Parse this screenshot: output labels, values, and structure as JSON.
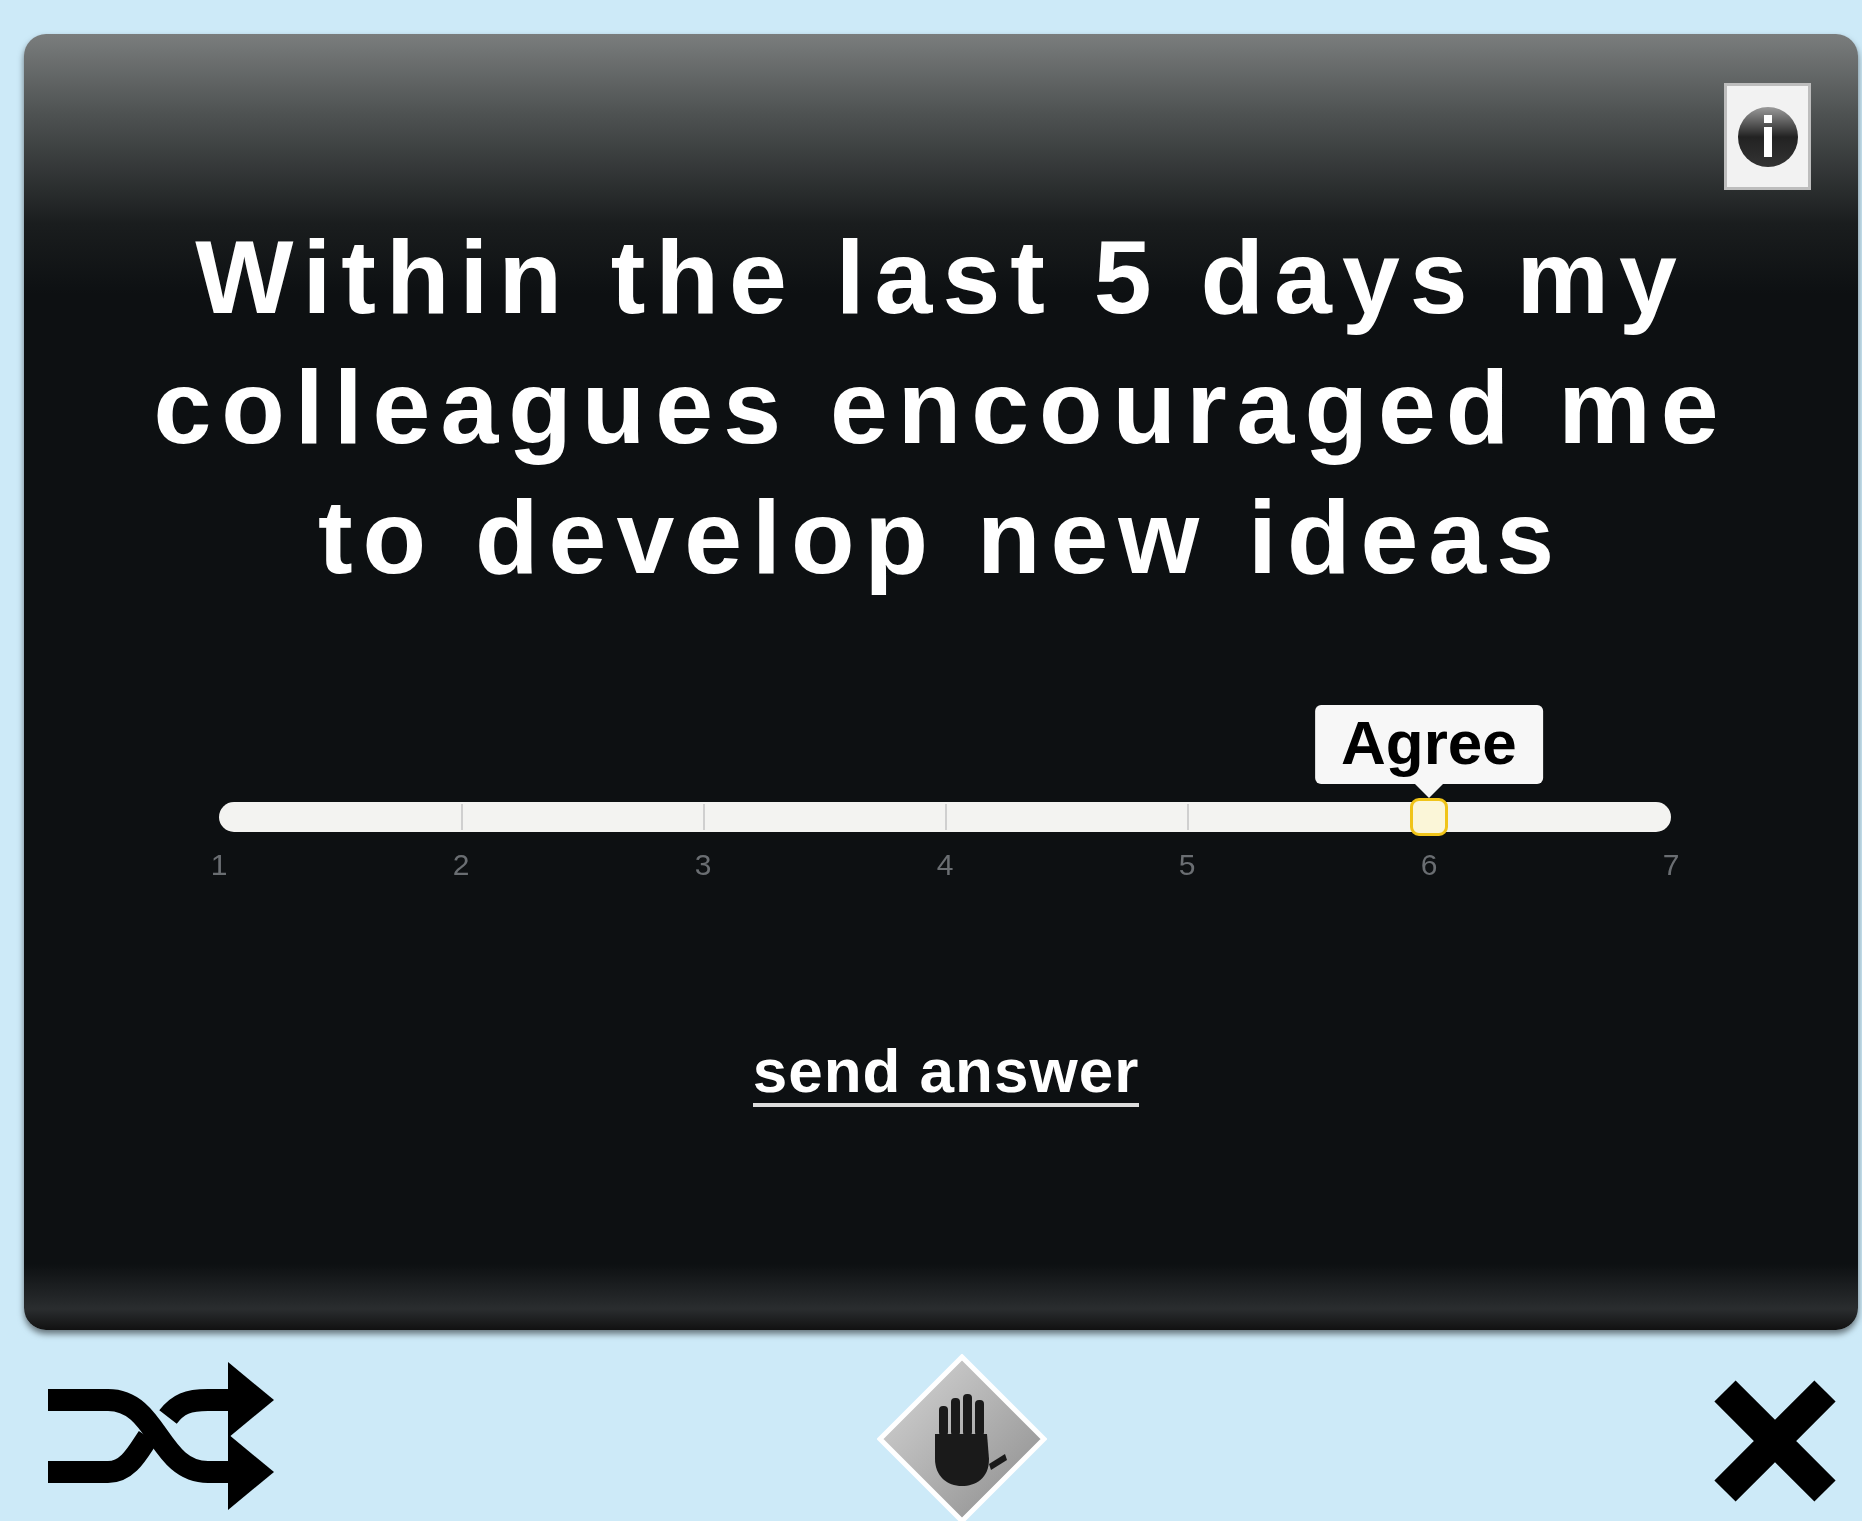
{
  "question": "Within the last 5 days my colleagues encouraged me to develop new ideas",
  "slider": {
    "level": 0.8333,
    "bubble": "Agree",
    "ticks": [
      "1",
      "2",
      "3",
      "4",
      "5",
      "6",
      "7"
    ]
  },
  "send_link": "send answer"
}
